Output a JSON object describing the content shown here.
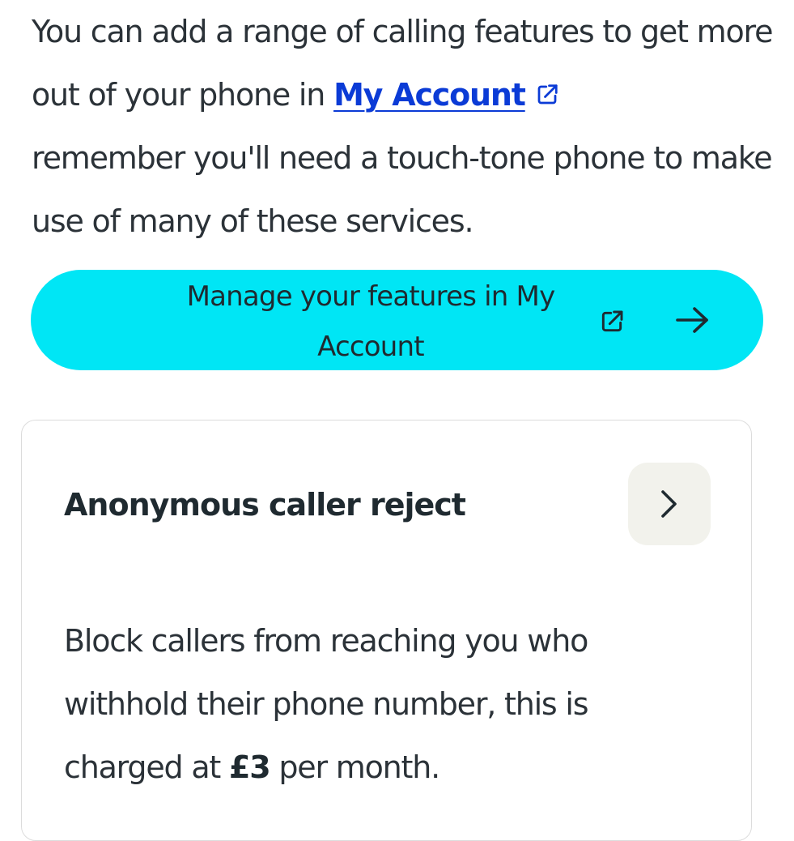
{
  "intro": {
    "text_before_link": "You can add a range of calling features to get more out of your phone in ",
    "link_label": "My Account",
    "text_after_link": "remember you'll need a touch-tone phone to make use of many of these services."
  },
  "cta": {
    "label": "Manage your features in My Account",
    "external_icon": "external-link-icon",
    "arrow_icon": "arrow-right-icon",
    "background": "#00e6f5"
  },
  "feature_card": {
    "title": "Anonymous caller reject",
    "expand_icon": "chevron-right-icon",
    "desc_before": "Block callers from reaching you who withhold their phone number, this is charged at ",
    "price": "£3",
    "desc_after": " per month."
  },
  "colors": {
    "link": "#0b3bd6",
    "text": "#2b3238",
    "accent": "#00e6f5"
  }
}
